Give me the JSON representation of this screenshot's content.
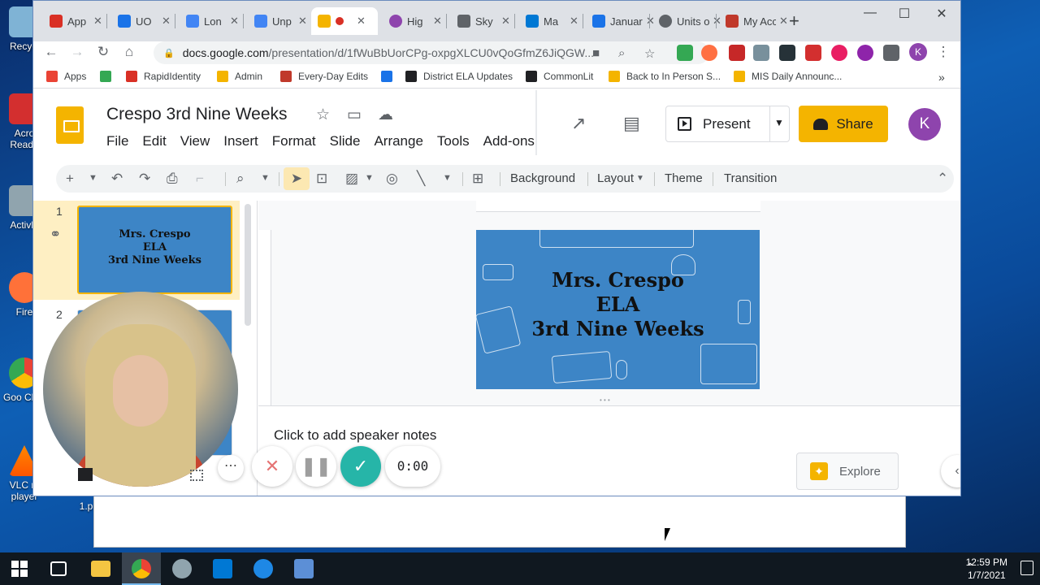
{
  "desktop": {
    "icons": [
      {
        "name": "recycle-bin-icon",
        "label": "Recycl"
      },
      {
        "name": "acrobat-icon",
        "label": "Acro Reade"
      },
      {
        "name": "activinspire-icon",
        "label": "Activln"
      },
      {
        "name": "firefox-icon",
        "label": "Fire"
      },
      {
        "name": "chrome-icon",
        "label": "Goo Chro"
      },
      {
        "name": "vlc-icon",
        "label": "VLC m player"
      }
    ],
    "partial_label": "1.p"
  },
  "browser": {
    "tabs": [
      {
        "title": "App",
        "color": "#d93025"
      },
      {
        "title": "UO",
        "color": "#1a73e8"
      },
      {
        "title": "Lon",
        "color": "#4285f4"
      },
      {
        "title": "Unp",
        "color": "#4285f4"
      },
      {
        "title": "",
        "color": "#f4b400",
        "active": true
      },
      {
        "title": "Hig",
        "color": "#8e44ad"
      },
      {
        "title": "Sky",
        "color": "#5f6368"
      },
      {
        "title": "Ma",
        "color": "#0078d4"
      },
      {
        "title": "January",
        "color": "#1a73e8"
      },
      {
        "title": "Units o",
        "color": "#5f6368"
      },
      {
        "title": "My Acc",
        "color": "#c0392b"
      }
    ],
    "url_host": "docs.google.com",
    "url_path": "/presentation/d/1fWuBbUorCPg-oxpgXLCU0vQoGfmZ6JiQGW...",
    "bookmarks": [
      {
        "label": "Apps",
        "color": "#ea4335"
      },
      {
        "label": "",
        "color": "#34a853"
      },
      {
        "label": "RapidIdentity",
        "color": "#d93025"
      },
      {
        "label": "Admin",
        "color": "#f4b400"
      },
      {
        "label": "Every-Day Edits",
        "color": "#c0392b"
      },
      {
        "label": "",
        "color": "#1a73e8"
      },
      {
        "label": "District ELA Updates",
        "color": "#202124"
      },
      {
        "label": "CommonLit",
        "color": "#202124"
      },
      {
        "label": "Back to In Person S...",
        "color": "#f4b400"
      },
      {
        "label": "MIS Daily Announc...",
        "color": "#f4b400"
      }
    ],
    "bookmarks_more": "»"
  },
  "slides": {
    "doc_title": "Crespo 3rd Nine Weeks",
    "menu": [
      "File",
      "Edit",
      "View",
      "Insert",
      "Format",
      "Slide",
      "Arrange",
      "Tools",
      "Add-ons"
    ],
    "present_label": "Present",
    "share_label": "Share",
    "avatar_letter": "K",
    "toolbar": {
      "background_label": "Background",
      "layout_label": "Layout",
      "theme_label": "Theme",
      "transition_label": "Transition"
    },
    "filmstrip": [
      {
        "num": "1",
        "lines": [
          "Mrs. Crespo",
          "ELA",
          "3rd Nine Weeks"
        ]
      },
      {
        "num": "2"
      }
    ],
    "main_slide": {
      "line1": "Mrs. Crespo",
      "line2": "ELA",
      "line3": "3rd Nine Weeks"
    },
    "notes_placeholder": "Click to add speaker notes",
    "explore_label": "Explore"
  },
  "recorder": {
    "timer": "0:00",
    "more": "⋯"
  },
  "taskbar": {
    "time": "12:59 PM",
    "date": "1/7/2021"
  },
  "colors": {
    "slide_bg": "#3d85c6",
    "accent_yellow": "#f4b400",
    "avatar_purple": "#8e44ad",
    "confirm_teal": "#26b5a8"
  }
}
